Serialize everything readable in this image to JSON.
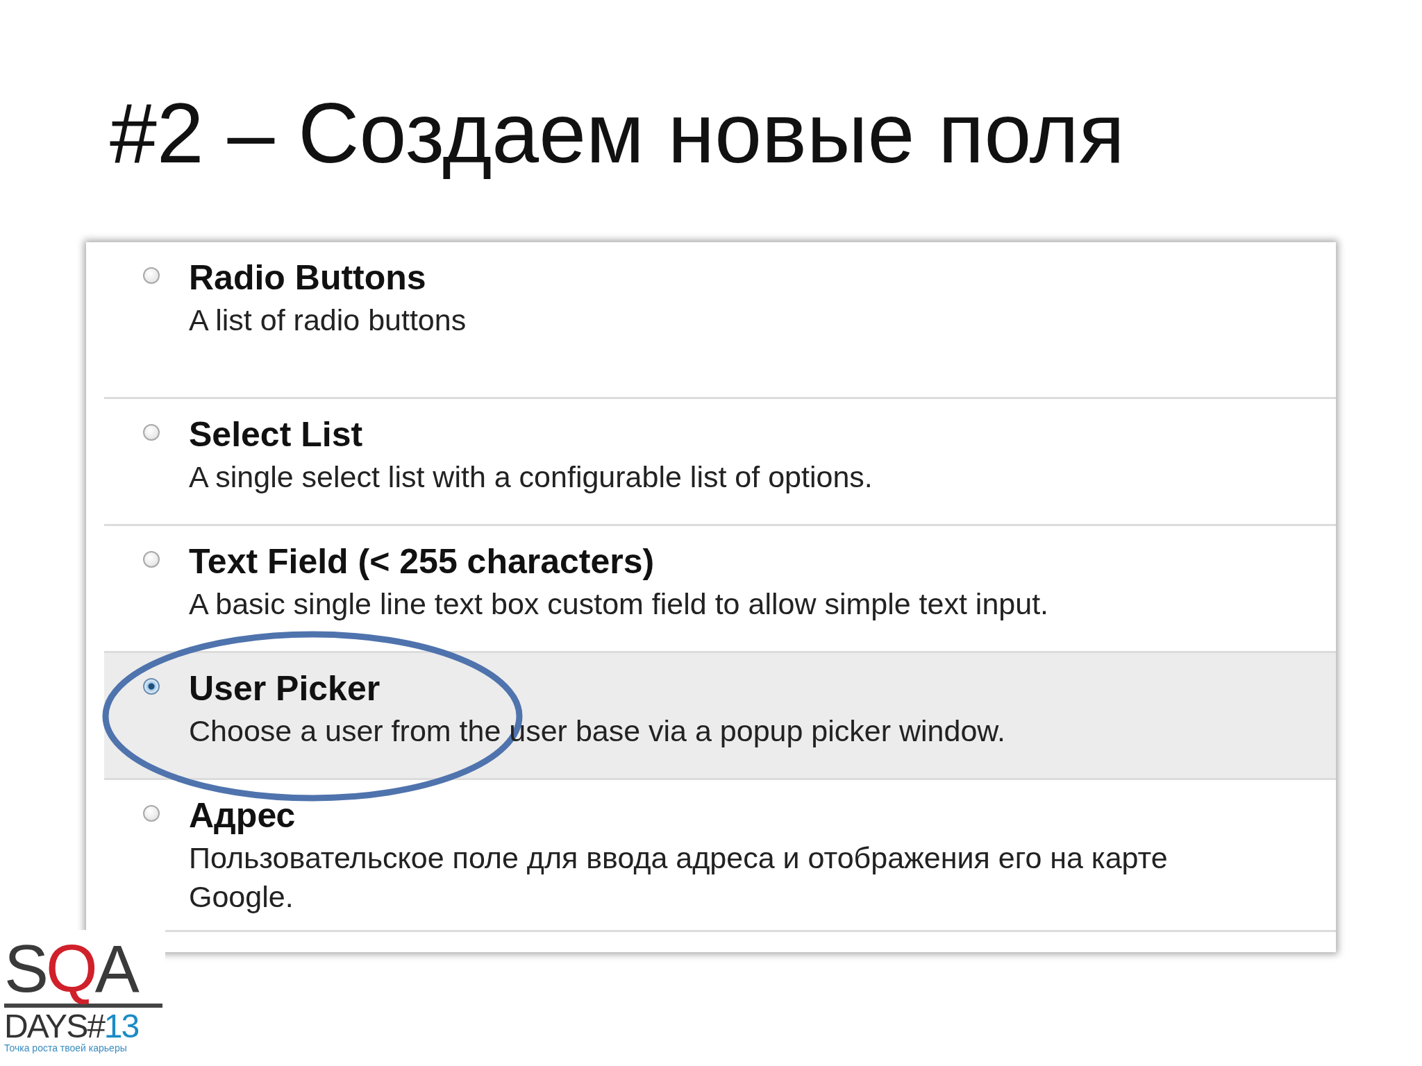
{
  "slide_title": "#2 – Создаем новые поля",
  "fields": [
    {
      "name": "Radio Buttons",
      "description": "A list of radio buttons",
      "selected": false
    },
    {
      "name": "Select List",
      "description": "A single select list with a configurable list of options.",
      "selected": false
    },
    {
      "name": "Text Field (< 255 characters)",
      "description": "A basic single line text box custom field to allow simple text input.",
      "selected": false
    },
    {
      "name": "User Picker",
      "description": "Choose a user from the user base via a popup picker window.",
      "selected": true
    },
    {
      "name": "Адрес",
      "description": "Пользовательское поле для ввода адреса и отображения его на карте Google.",
      "selected": false
    }
  ],
  "logo": {
    "wordmark": [
      {
        "text": "S",
        "accent": false
      },
      {
        "text": "Q",
        "accent": true
      },
      {
        "text": "A",
        "accent": false
      }
    ],
    "edition": [
      {
        "text": "DAYS#",
        "accent": false
      },
      {
        "text": "13",
        "accent": true
      }
    ],
    "tagline": "Точка роста твоей карьеры"
  }
}
